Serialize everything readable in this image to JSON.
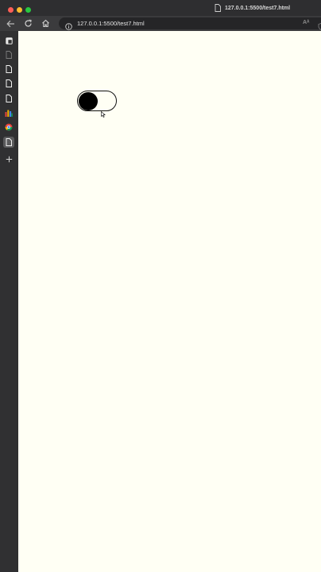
{
  "window": {
    "tab_title": "127.0.0.1:5500/test7.html"
  },
  "toolbar": {
    "url": "127.0.0.1:5500/test7.html",
    "read_aloud_label": "Aᴬ"
  },
  "sidebar": {
    "items": [
      {
        "icon": "collections-icon"
      },
      {
        "icon": "page-icon"
      },
      {
        "icon": "page-icon"
      },
      {
        "icon": "page-icon"
      },
      {
        "icon": "page-icon"
      },
      {
        "icon": "bar-chart-icon"
      },
      {
        "icon": "browser-logo-icon"
      },
      {
        "icon": "page-icon",
        "active": true
      },
      {
        "icon": "add-icon"
      }
    ]
  },
  "page": {
    "toggle": {
      "state": "off",
      "track_color": "#fffff4",
      "knob_color": "#000000"
    }
  },
  "colors": {
    "page_background": "#fffff4",
    "chrome_background": "#3b3b3d",
    "sidebar_background": "#303032"
  }
}
